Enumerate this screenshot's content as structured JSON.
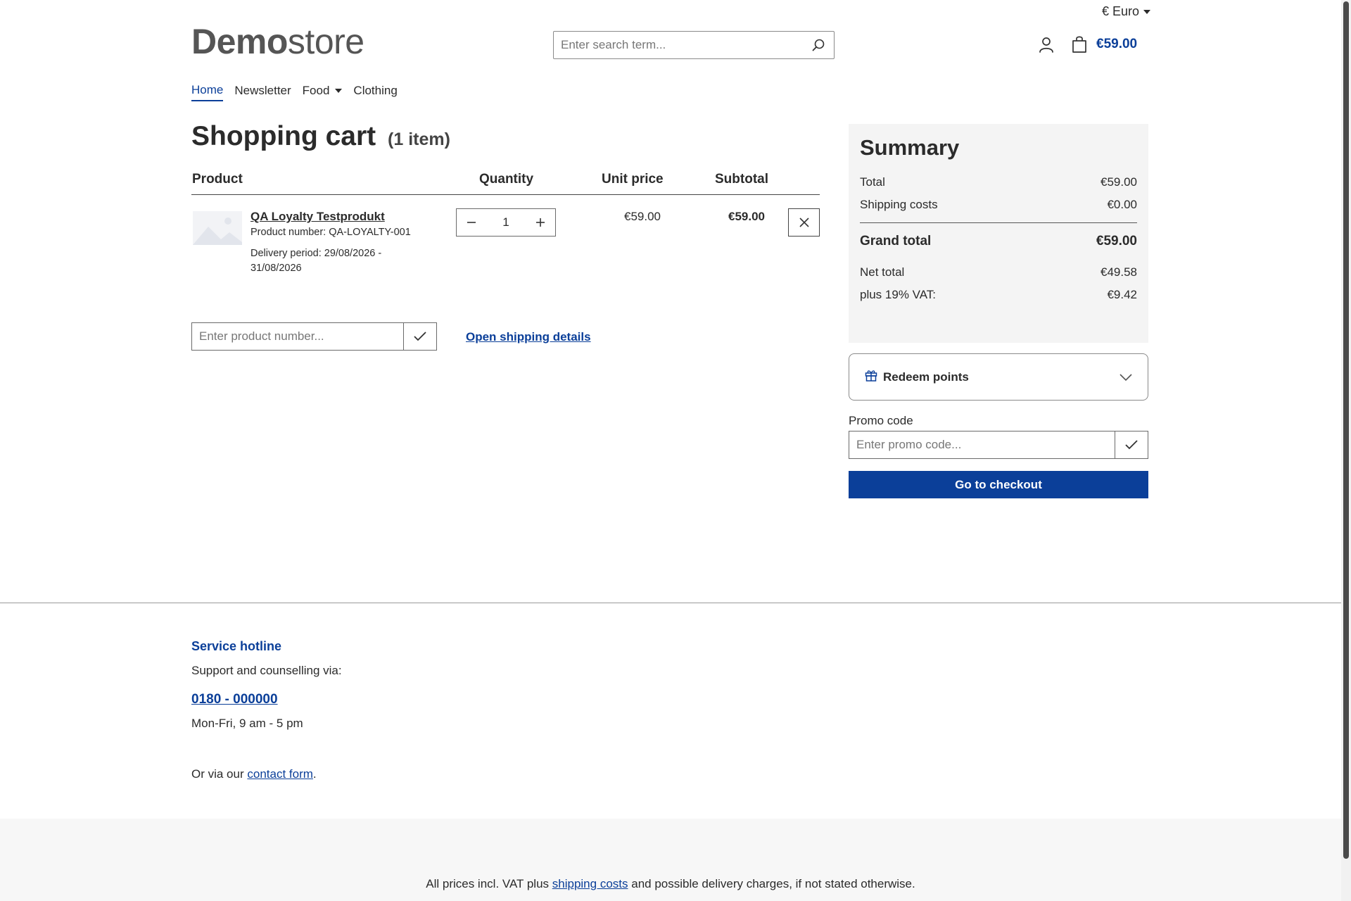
{
  "header": {
    "currency": "€ Euro",
    "logo_bold": "Demo",
    "logo_light": "store",
    "search_placeholder": "Enter search term...",
    "cart_total": "€59.00"
  },
  "nav": {
    "items": [
      {
        "label": "Home",
        "active": true
      },
      {
        "label": "Newsletter"
      },
      {
        "label": "Food",
        "dropdown": true
      },
      {
        "label": "Clothing"
      }
    ]
  },
  "cart": {
    "title": "Shopping cart",
    "item_count": "(1 item)",
    "columns": {
      "product": "Product",
      "quantity": "Quantity",
      "unit_price": "Unit price",
      "subtotal": "Subtotal"
    },
    "items": [
      {
        "name": "QA Loyalty Testprodukt",
        "product_number": "Product number: QA-LOYALTY-001",
        "delivery": "Delivery period: 29/08/2026 - 31/08/2026",
        "quantity": "1",
        "unit_price": "€59.00",
        "subtotal": "€59.00"
      }
    ],
    "add_product_placeholder": "Enter product number...",
    "shipping_link": "Open shipping details"
  },
  "summary": {
    "title": "Summary",
    "total_label": "Total",
    "total": "€59.00",
    "shipping_label": "Shipping costs",
    "shipping": "€0.00",
    "grand_total_label": "Grand total",
    "grand_total": "€59.00",
    "net_label": "Net total",
    "net": "€49.58",
    "vat_label": "plus 19% VAT:",
    "vat": "€9.42",
    "redeem_label": "Redeem points",
    "promo_label": "Promo code",
    "promo_placeholder": "Enter promo code...",
    "checkout_label": "Go to checkout"
  },
  "footer": {
    "hotline_title": "Service hotline",
    "hotline_sub": "Support and counselling via:",
    "phone": "0180 - 000000",
    "hours": "Mon-Fri, 9 am - 5 pm",
    "contact_prefix": "Or via our",
    "contact_link": "contact form",
    "contact_suffix": ".",
    "vat_prefix": "All prices incl. VAT plus",
    "vat_link": "shipping costs",
    "vat_suffix": "and possible delivery charges, if not stated otherwise."
  },
  "colors": {
    "accent": "#0b3f99",
    "panel": "#f4f4f4"
  }
}
